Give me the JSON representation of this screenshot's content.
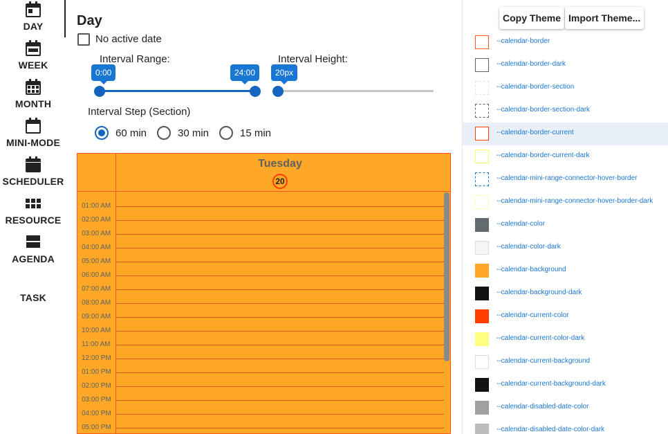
{
  "nav": {
    "items": [
      {
        "label": "DAY",
        "icon": "calendar-day-icon"
      },
      {
        "label": "WEEK",
        "icon": "calendar-week-icon"
      },
      {
        "label": "MONTH",
        "icon": "calendar-month-icon"
      },
      {
        "label": "MINI-MODE",
        "icon": "calendar-blank-icon"
      },
      {
        "label": "SCHEDULER",
        "icon": "calendar-filled-icon"
      },
      {
        "label": "RESOURCE",
        "icon": "grid-icon"
      },
      {
        "label": "AGENDA",
        "icon": "agenda-icon"
      },
      {
        "label": "TASK",
        "icon": ""
      }
    ]
  },
  "main": {
    "title": "Day",
    "no_active_date_label": "No active date",
    "interval_range": {
      "label": "Interval Range:",
      "min": "0:00",
      "max": "24:00",
      "start_fraction": 0.0,
      "end_fraction": 1.0
    },
    "interval_height": {
      "label": "Interval Height:",
      "value": "20px",
      "fraction": 0.0
    },
    "interval_step": {
      "label": "Interval Step (Section)",
      "options": [
        "60 min",
        "30 min",
        "15 min"
      ],
      "selected": "60 min"
    }
  },
  "calendar": {
    "weekday": "Tuesday",
    "date": "20",
    "background": "#ffa726",
    "border_color": "#ff5722",
    "times": [
      "01:00 AM",
      "02:00 AM",
      "03:00 AM",
      "04:00 AM",
      "05:00 AM",
      "06:00 AM",
      "07:00 AM",
      "08:00 AM",
      "09:00 AM",
      "10:00 AM",
      "11:00 AM",
      "12:00 PM",
      "01:00 PM",
      "02:00 PM",
      "03:00 PM",
      "04:00 PM",
      "05:00 PM"
    ]
  },
  "theme": {
    "copy_button": "Copy Theme",
    "import_button": "Import Theme...",
    "swatches": [
      {
        "name": "--calendar-border",
        "color": "#ff5722",
        "style": "solid"
      },
      {
        "name": "--calendar-border-dark",
        "color": "#616161",
        "style": "solid"
      },
      {
        "name": "--calendar-border-section",
        "color": "#e0e0e0",
        "style": "dashed"
      },
      {
        "name": "--calendar-border-section-dark",
        "color": "#616161",
        "style": "dashed"
      },
      {
        "name": "--calendar-border-current",
        "color": "#ff3d00",
        "style": "solid"
      },
      {
        "name": "--calendar-border-current-dark",
        "color": "#ffff66",
        "style": "solid"
      },
      {
        "name": "--calendar-mini-range-connector-hover-border",
        "color": "#1976d2",
        "style": "dashed"
      },
      {
        "name": "--calendar-mini-range-connector-hover-border-dark",
        "color": "#ffffa0",
        "style": "dashed"
      },
      {
        "name": "--calendar-color",
        "color": "#636b6f",
        "fill": "#636b6f"
      },
      {
        "name": "--calendar-color-dark",
        "color": "#dddddd",
        "fill": "#f5f5f5"
      },
      {
        "name": "--calendar-background",
        "color": "#ffa726",
        "fill": "#ffa726"
      },
      {
        "name": "--calendar-background-dark",
        "color": "#121212",
        "fill": "#121212"
      },
      {
        "name": "--calendar-current-color",
        "color": "#ff3d00",
        "fill": "#ff3d00"
      },
      {
        "name": "--calendar-current-color-dark",
        "color": "#ffff80",
        "fill": "#ffff80"
      },
      {
        "name": "--calendar-current-background",
        "color": "#dddddd",
        "fill": "#ffffff"
      },
      {
        "name": "--calendar-current-background-dark",
        "color": "#121212",
        "fill": "#121212"
      },
      {
        "name": "--calendar-disabled-date-color",
        "color": "#a0a0a0",
        "fill": "#a0a0a0"
      },
      {
        "name": "--calendar-disabled-date-color-dark",
        "color": "#bdbdbd",
        "fill": "#bdbdbd"
      }
    ],
    "highlighted_index": 4
  }
}
